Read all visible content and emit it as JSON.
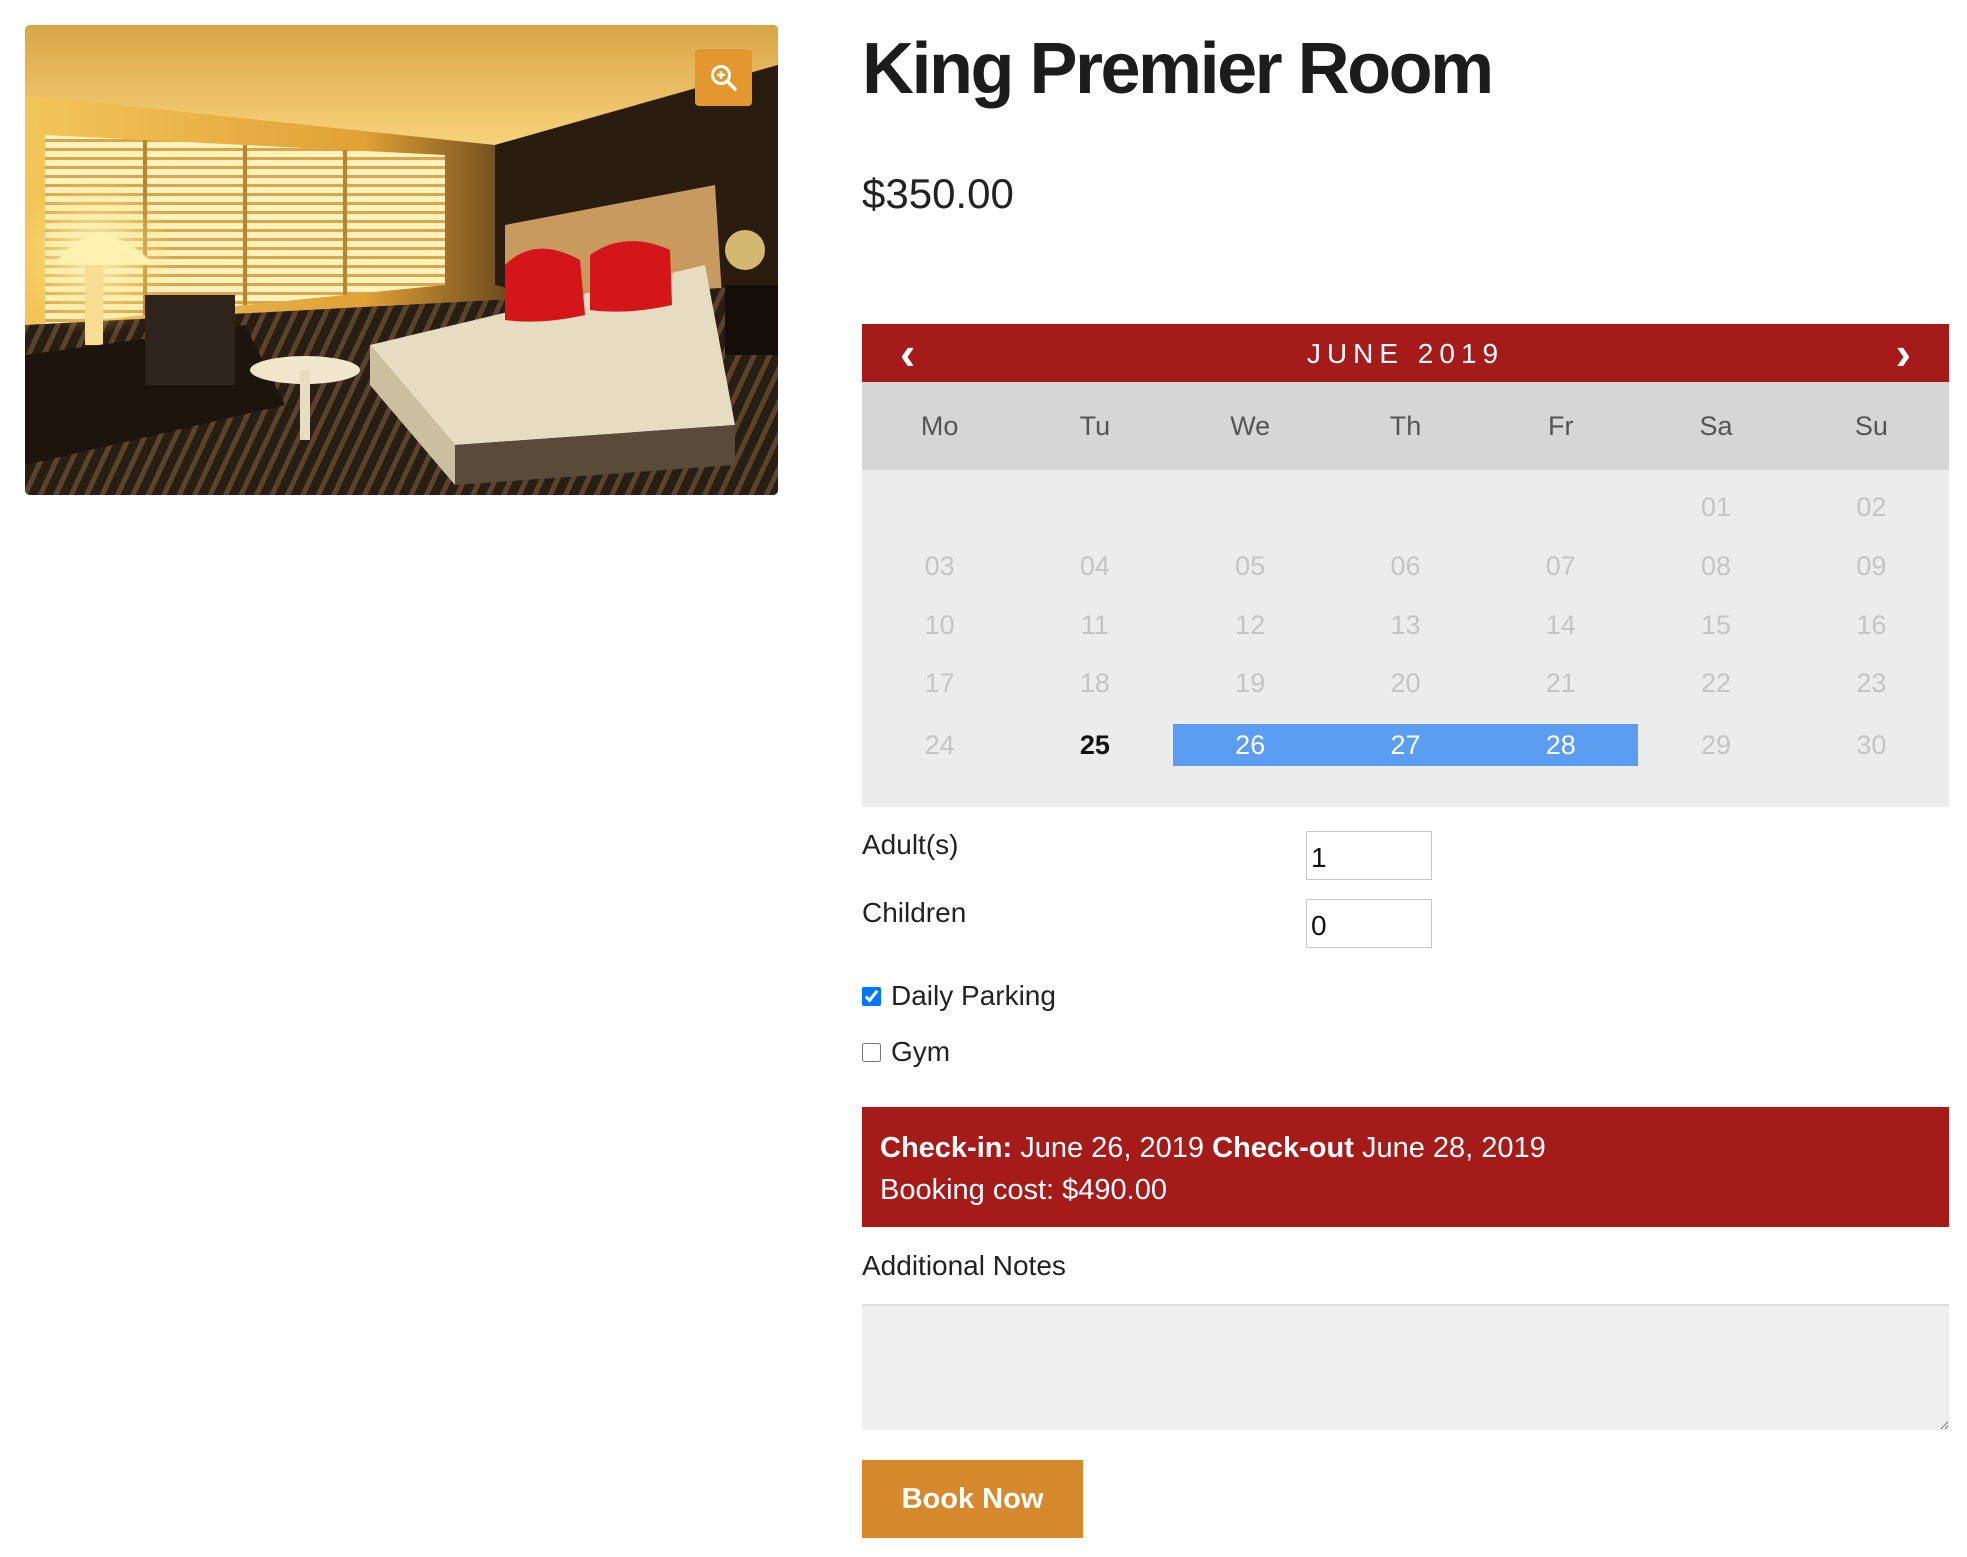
{
  "product": {
    "title": "King Premier Room",
    "price": "$350.00"
  },
  "gallery": {
    "zoom_icon": "zoom-in-icon",
    "accent_color": "#e3972e"
  },
  "calendar": {
    "month_label": "JUNE 2019",
    "prev_label": "‹",
    "next_label": "›",
    "header_color": "#a51b19",
    "selected_color": "#5b9df0",
    "weekdays": [
      "Mo",
      "Tu",
      "We",
      "Th",
      "Fr",
      "Sa",
      "Su"
    ],
    "weeks": [
      [
        "",
        "",
        "",
        "",
        "",
        "01",
        "02"
      ],
      [
        "03",
        "04",
        "05",
        "06",
        "07",
        "08",
        "09"
      ],
      [
        "10",
        "11",
        "12",
        "13",
        "14",
        "15",
        "16"
      ],
      [
        "17",
        "18",
        "19",
        "20",
        "21",
        "22",
        "23"
      ],
      [
        "24",
        "25",
        "26",
        "27",
        "28",
        "29",
        "30"
      ]
    ],
    "today": "25",
    "selected": [
      "26",
      "27",
      "28"
    ]
  },
  "guests": {
    "adults_label": "Adult(s)",
    "adults_value": "1",
    "children_label": "Children",
    "children_value": "0"
  },
  "extras": [
    {
      "label": "Daily Parking",
      "checked": true
    },
    {
      "label": "Gym",
      "checked": false
    }
  ],
  "booking": {
    "checkin_label": "Check-in:",
    "checkin_date": "June 26, 2019",
    "checkout_label": "Check-out",
    "checkout_date": "June 28, 2019",
    "cost_text": "Booking cost: $490.00"
  },
  "notes": {
    "label": "Additional Notes",
    "value": ""
  },
  "book_button": {
    "label": "Book Now",
    "color": "#d6892c"
  }
}
